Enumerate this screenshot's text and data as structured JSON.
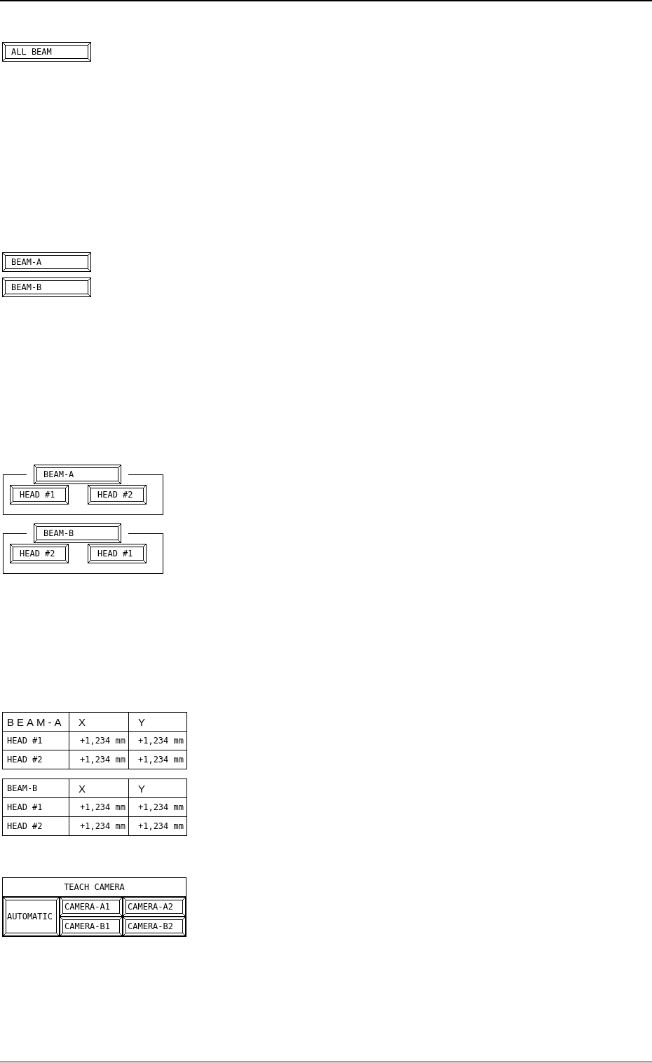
{
  "all_beam_button": {
    "label": "ALL BEAM"
  },
  "beam_buttons": [
    {
      "label": "BEAM-A"
    },
    {
      "label": "BEAM-B"
    }
  ],
  "beam_groups": [
    {
      "beam": "BEAM-A",
      "heads": [
        "HEAD #1",
        "HEAD #2"
      ]
    },
    {
      "beam": "BEAM-B",
      "heads": [
        "HEAD #2",
        "HEAD #1"
      ]
    }
  ],
  "offset_tables": [
    {
      "kind": "wide",
      "columns": [
        "BEAM-A",
        "X",
        "Y"
      ],
      "rows": [
        [
          "HEAD #1",
          "+1,234 mm",
          "+1,234 mm"
        ],
        [
          "HEAD #2",
          "+1,234 mm",
          "+1,234 mm"
        ]
      ]
    },
    {
      "kind": "plain",
      "columns": [
        "BEAM-B",
        "X",
        "Y"
      ],
      "rows": [
        [
          "HEAD #1",
          "+1,234 mm",
          "+1,234 mm"
        ],
        [
          "HEAD #2",
          "+1,234 mm",
          "+1,234 mm"
        ]
      ]
    }
  ],
  "teach_camera": {
    "title": "TEACH CAMERA",
    "automatic": "AUTOMATIC",
    "cameras": [
      "CAMERA-A1",
      "CAMERA-A2",
      "CAMERA-B1",
      "CAMERA-B2"
    ]
  }
}
